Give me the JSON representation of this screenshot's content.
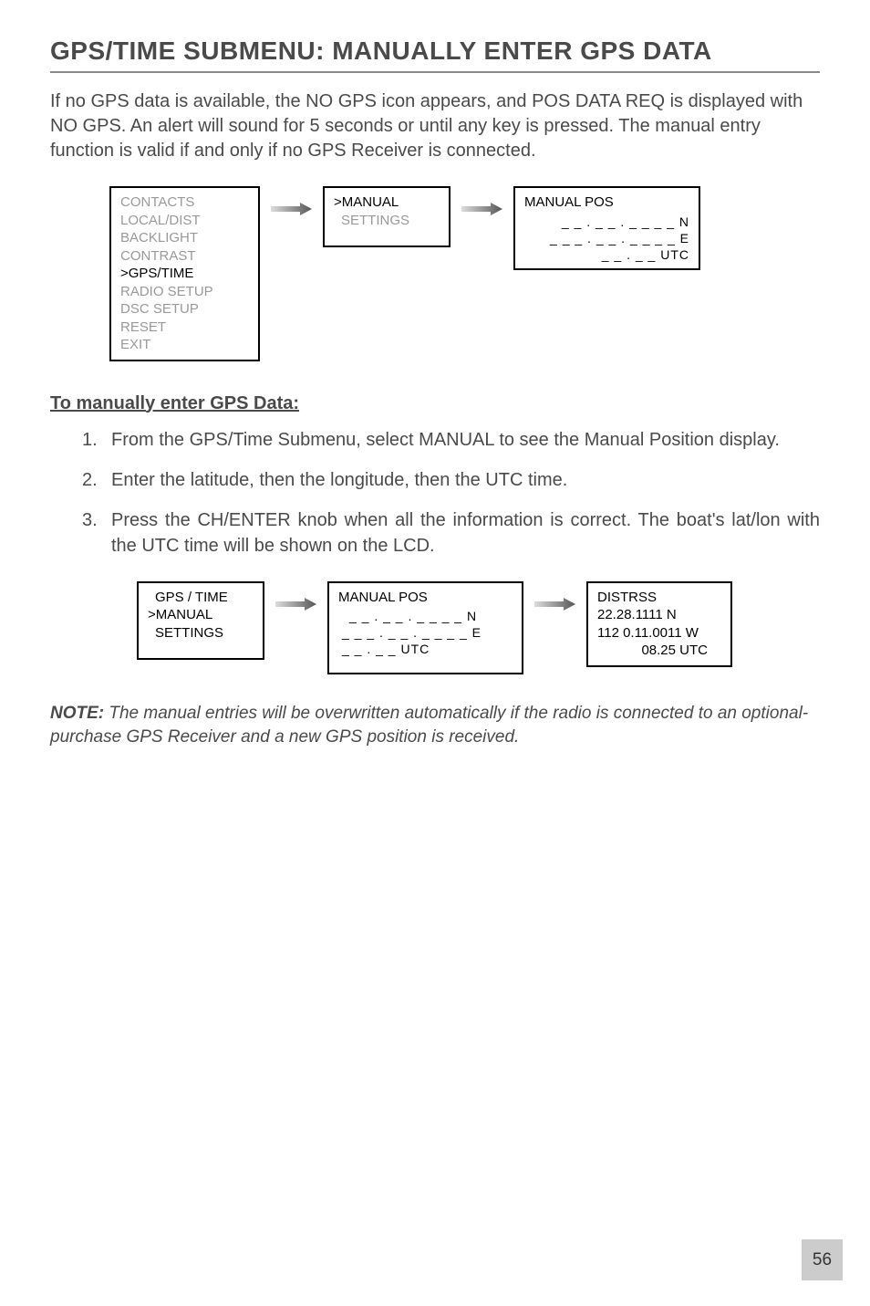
{
  "title": "GPS/TIME SUBMENU: MANUALLY ENTER GPS DATA",
  "intro": "If no GPS data is available, the NO GPS icon appears, and POS DATA REQ is displayed with NO GPS. An alert will sound for 5 seconds or until any key is pressed. The manual entry function is valid if and only if no GPS Receiver is connected.",
  "diagram1": {
    "menu": {
      "items": [
        "CONTACTS",
        "LOCAL/DIST",
        "BACKLIGHT",
        "CONTRAST",
        ">GPS/TIME",
        "RADIO SETUP",
        "DSC SETUP",
        "RESET",
        "EXIT"
      ],
      "active_index": 4
    },
    "submenu": {
      "line1": ">MANUAL",
      "line2": "SETTINGS"
    },
    "pos": {
      "header": "MANUAL POS",
      "lat": "_ _ . _ _ . _ _ _ _ N",
      "lon": "_ _ _ . _ _ . _ _ _ _ E",
      "utc": "_ _ . _ _ UTC"
    }
  },
  "subheading": "To manually enter GPS Data:",
  "steps": [
    {
      "num": "1.",
      "text": "From the GPS/Time Submenu, select MANUAL to see the Manual Position display."
    },
    {
      "num": "2.",
      "text": "Enter the latitude, then the longitude, then the UTC time."
    },
    {
      "num": "3.",
      "text": "Press the CH/ENTER knob when all the information is correct. The boat's lat/lon with the UTC time will be shown on the LCD."
    }
  ],
  "diagram2": {
    "menu": {
      "line1": "GPS / TIME",
      "line2": ">MANUAL",
      "line3": "SETTINGS"
    },
    "pos": {
      "header": "MANUAL POS",
      "lat": "_ _ . _ _ . _ _ _ _ N",
      "lon": "_ _ _ . _ _ . _ _ _ _ E",
      "utc": "_ _ . _ _ UTC"
    },
    "result": {
      "line1": "DISTRSS",
      "line2": "22.28.1111 N",
      "line3": "112 0.11.0011 W",
      "line4": "08.25 UTC"
    }
  },
  "note_label": "NOTE:",
  "note_text": " The manual entries will be overwritten automatically if the radio is connected to an optional-purchase GPS Receiver and a new GPS position is received.",
  "page_number": "56"
}
